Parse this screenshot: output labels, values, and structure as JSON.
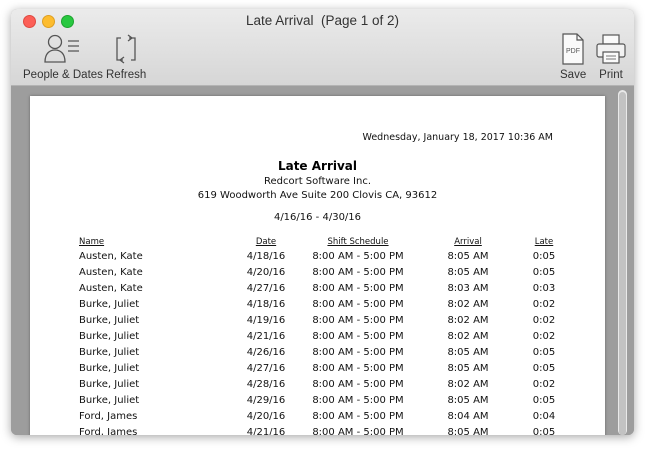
{
  "window": {
    "title": "Late Arrival  (Page 1 of 2)"
  },
  "toolbar": {
    "people_dates_label": "People & Dates",
    "refresh_label": "Refresh",
    "save_label": "Save",
    "print_label": "Print",
    "pdf_icon_text": "PDF"
  },
  "report": {
    "timestamp": "Wednesday, January 18, 2017  10:36 AM",
    "title": "Late Arrival",
    "company": "Redcort Software Inc.",
    "address": "619 Woodworth Ave Suite 200  Clovis CA, 93612",
    "date_range": "4/16/16 - 4/30/16",
    "columns": {
      "name": "Name",
      "date": "Date",
      "shift": "Shift Schedule",
      "arrival": "Arrival",
      "late": "Late"
    },
    "rows": [
      {
        "name": "Austen, Kate",
        "date": "4/18/16",
        "shift": "8:00 AM - 5:00 PM",
        "arrival": "8:05 AM",
        "late": "0:05"
      },
      {
        "name": "Austen, Kate",
        "date": "4/20/16",
        "shift": "8:00 AM - 5:00 PM",
        "arrival": "8:05 AM",
        "late": "0:05"
      },
      {
        "name": "Austen, Kate",
        "date": "4/27/16",
        "shift": "8:00 AM - 5:00 PM",
        "arrival": "8:03 AM",
        "late": "0:03"
      },
      {
        "name": "Burke, Juliet",
        "date": "4/18/16",
        "shift": "8:00 AM - 5:00 PM",
        "arrival": "8:02 AM",
        "late": "0:02"
      },
      {
        "name": "Burke, Juliet",
        "date": "4/19/16",
        "shift": "8:00 AM - 5:00 PM",
        "arrival": "8:02 AM",
        "late": "0:02"
      },
      {
        "name": "Burke, Juliet",
        "date": "4/21/16",
        "shift": "8:00 AM - 5:00 PM",
        "arrival": "8:02 AM",
        "late": "0:02"
      },
      {
        "name": "Burke, Juliet",
        "date": "4/26/16",
        "shift": "8:00 AM - 5:00 PM",
        "arrival": "8:05 AM",
        "late": "0:05"
      },
      {
        "name": "Burke, Juliet",
        "date": "4/27/16",
        "shift": "8:00 AM - 5:00 PM",
        "arrival": "8:05 AM",
        "late": "0:05"
      },
      {
        "name": "Burke, Juliet",
        "date": "4/28/16",
        "shift": "8:00 AM - 5:00 PM",
        "arrival": "8:02 AM",
        "late": "0:02"
      },
      {
        "name": "Burke, Juliet",
        "date": "4/29/16",
        "shift": "8:00 AM - 5:00 PM",
        "arrival": "8:05 AM",
        "late": "0:05"
      },
      {
        "name": "Ford, James",
        "date": "4/20/16",
        "shift": "8:00 AM - 5:00 PM",
        "arrival": "8:04 AM",
        "late": "0:04"
      },
      {
        "name": "Ford, James",
        "date": "4/21/16",
        "shift": "8:00 AM - 5:00 PM",
        "arrival": "8:05 AM",
        "late": "0:05"
      }
    ]
  }
}
